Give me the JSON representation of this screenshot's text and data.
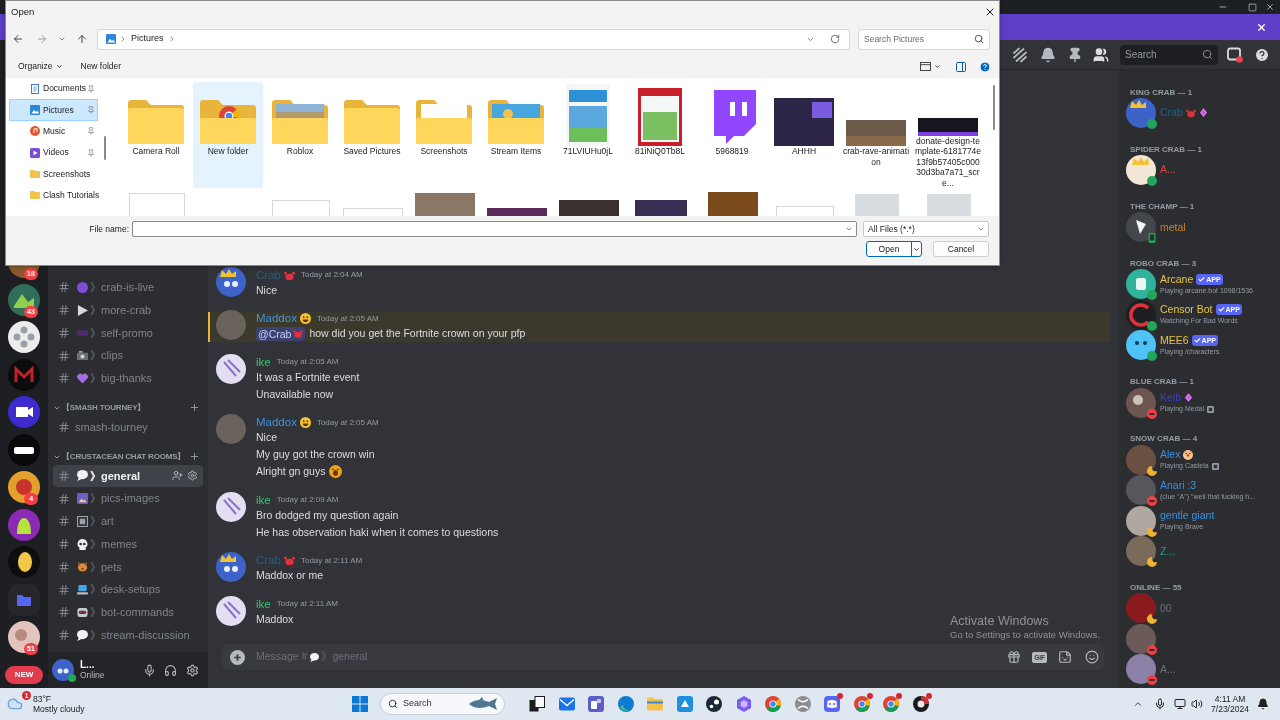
{
  "file_dialog": {
    "title": "Open",
    "path": "Pictures",
    "search": {
      "placeholder": "Search Pictures"
    },
    "toolbar": [
      {
        "label": "Organize",
        "kind": "menu"
      },
      {
        "label": "New folder",
        "kind": "button"
      }
    ],
    "nav": [
      {
        "label": "Documents",
        "pinned": true,
        "selected": false
      },
      {
        "label": "Pictures",
        "pinned": true,
        "selected": true
      },
      {
        "label": "Music",
        "pinned": true,
        "selected": false
      },
      {
        "label": "Videos",
        "pinned": true,
        "selected": false
      },
      {
        "label": "Screenshots",
        "pinned": false,
        "selected": false
      },
      {
        "label": "Clash Tutorials",
        "pinned": false,
        "selected": false
      }
    ],
    "items": [
      {
        "name": "Camera Roll",
        "kind": "folder",
        "highlighted": false
      },
      {
        "name": "New folder",
        "kind": "folder_preview",
        "highlighted": true
      },
      {
        "name": "Roblox",
        "kind": "folder_preview",
        "highlighted": false
      },
      {
        "name": "Saved Pictures",
        "kind": "folder",
        "highlighted": false
      },
      {
        "name": "Screenshots",
        "kind": "folder_preview",
        "highlighted": false
      },
      {
        "name": "Stream Items",
        "kind": "folder_preview",
        "highlighted": false
      },
      {
        "name": "71LVIUHu0jL",
        "kind": "image",
        "highlighted": false
      },
      {
        "name": "81iNiQ0Tb8L",
        "kind": "image",
        "highlighted": false
      },
      {
        "name": "5968819",
        "kind": "image",
        "highlighted": false
      },
      {
        "name": "AHHH",
        "kind": "image",
        "highlighted": false
      },
      {
        "name": "crab-rave-animation",
        "kind": "image",
        "highlighted": false
      },
      {
        "name": "donate-design-template-6181774e13f9b57405c00030d3ba7a71_scre...",
        "kind": "image",
        "highlighted": false
      }
    ],
    "file_name_label": "File name:",
    "filter": "All Files (*.*)",
    "buttons": [
      {
        "label": "Open",
        "primary": true
      },
      {
        "label": "Cancel",
        "primary": false
      }
    ]
  },
  "discord": {
    "servers": [
      {
        "kind": "server",
        "badge": "18"
      },
      {
        "kind": "server",
        "badge": "43"
      },
      {
        "kind": "server"
      },
      {
        "kind": "server"
      },
      {
        "kind": "server"
      },
      {
        "kind": "server"
      },
      {
        "kind": "server",
        "badge": "4"
      },
      {
        "kind": "server"
      },
      {
        "kind": "server"
      },
      {
        "kind": "folder"
      },
      {
        "kind": "server",
        "badge": "51"
      },
      {
        "kind": "new",
        "label": "NEW"
      }
    ],
    "channels": [
      {
        "kind": "channel",
        "name": "》crab-is-live",
        "selected": false
      },
      {
        "kind": "channel",
        "name": "》more-crab",
        "selected": false
      },
      {
        "kind": "channel",
        "name": "》self-promo",
        "selected": false
      },
      {
        "kind": "channel",
        "name": "》clips",
        "selected": false
      },
      {
        "kind": "channel",
        "name": "》big-thanks",
        "selected": false
      },
      {
        "kind": "category",
        "name": "【SMASH TOURNEY】",
        "expanded": true
      },
      {
        "kind": "plain_channel",
        "name": "smash-tourney",
        "selected": false
      },
      {
        "kind": "category",
        "name": "【CRUSTACEAN CHAT ROOMS】",
        "expanded": true
      },
      {
        "kind": "channel",
        "name": "》general",
        "selected": true
      },
      {
        "kind": "channel",
        "name": "》pics-images",
        "selected": false
      },
      {
        "kind": "channel",
        "name": "》art",
        "selected": false
      },
      {
        "kind": "channel",
        "name": "》memes",
        "selected": false
      },
      {
        "kind": "channel",
        "name": "》pets",
        "selected": false
      },
      {
        "kind": "channel",
        "name": "》desk-setups",
        "selected": false
      },
      {
        "kind": "channel",
        "name": "》bot-commands",
        "selected": false
      },
      {
        "kind": "channel",
        "name": "》stream-discussion",
        "selected": false
      }
    ],
    "user": {
      "name": "L...",
      "status": "Online",
      "kind": "online"
    },
    "search": {
      "placeholder": "Search"
    },
    "messages": [
      {
        "author": "Crab",
        "color": "#22608a",
        "time": "Today at 2:04 AM",
        "mentioned": false,
        "lines": [
          {
            "kind": "text",
            "text": "Nice"
          }
        ]
      },
      {
        "author": "Maddox",
        "color": "#3f93d9",
        "time": "Today at 2:05 AM",
        "mentioned": true,
        "lines": [
          {
            "kind": "mention",
            "mention": "@Crab",
            "text": "how did you get the Fortnite crown on your pfp"
          }
        ]
      },
      {
        "author": "ike",
        "color": "#2fcc6a",
        "time": "Today at 2:05 AM",
        "mentioned": false,
        "lines": [
          {
            "kind": "text",
            "text": "It was a Fortnite event"
          },
          {
            "kind": "text",
            "text": "Unavailable now"
          }
        ]
      },
      {
        "author": "Maddox",
        "color": "#3f93d9",
        "time": "Today at 2:05 AM",
        "mentioned": false,
        "lines": [
          {
            "kind": "text",
            "text": "Nice"
          },
          {
            "kind": "text",
            "text": "My guy got the crown win"
          },
          {
            "kind": "emoji",
            "text": "Alright gn guys"
          }
        ]
      },
      {
        "author": "ike",
        "color": "#2fcc6a",
        "time": "Today at 2:09 AM",
        "mentioned": false,
        "lines": [
          {
            "kind": "text",
            "text": "Bro dodged my question again"
          },
          {
            "kind": "text",
            "text": "He has observation haki when it comes to questions"
          }
        ]
      },
      {
        "author": "Crab",
        "color": "#22608a",
        "time": "Today at 2:11 AM",
        "mentioned": false,
        "lines": [
          {
            "kind": "text",
            "text": "Maddox or me"
          }
        ]
      },
      {
        "author": "ike",
        "color": "#2fcc6a",
        "time": "Today at 2:11 AM",
        "mentioned": false,
        "lines": [
          {
            "kind": "text",
            "text": "Maddox"
          }
        ]
      }
    ],
    "composer": {
      "placeholder": "Message #",
      "channel": "》general",
      "gif_label": "GIF"
    },
    "member_sections": [
      {
        "title": "KING CRAB — 1",
        "members": [
          {
            "name": "Crab",
            "color": "#22608a",
            "kind": "online",
            "boosting": true
          }
        ]
      },
      {
        "title": "SPIDER CRAB — 1",
        "members": [
          {
            "name": "A...",
            "color": "#d8453f",
            "kind": "online",
            "boosting": false
          }
        ]
      },
      {
        "title": "THE CHAMP — 1",
        "members": [
          {
            "name": "metal",
            "color": "#c8802e",
            "kind": "mobile",
            "boosting": false
          }
        ]
      },
      {
        "title": "ROBO CRAB — 3",
        "members": [
          {
            "name": "Arcane",
            "color": "#e8c547",
            "kind": "online",
            "boosting": false,
            "tag": "APP",
            "activity": "Playing arcane.bot 1098/1536"
          },
          {
            "name": "Censor Bot",
            "color": "#e8c547",
            "kind": "online",
            "boosting": false,
            "tag": "APP",
            "activity": "Watching For Bad Words"
          },
          {
            "name": "MEE6",
            "color": "#e8c547",
            "kind": "online",
            "boosting": false,
            "tag": "APP",
            "activity": "Playing /characters"
          }
        ]
      },
      {
        "title": "BLUE CRAB — 1",
        "members": [
          {
            "name": "Kelb",
            "color": "#3f3bd1",
            "kind": "dnd",
            "boosting": true,
            "activity": "Playing Medal"
          }
        ]
      },
      {
        "title": "SNOW CRAB — 4",
        "members": [
          {
            "name": "Alex",
            "color": "#3d8fdc",
            "kind": "idle",
            "boosting": false,
            "activity": "Playing Castela"
          },
          {
            "name": "Anari :3",
            "color": "#3d8fdc",
            "kind": "dnd",
            "boosting": false,
            "activity": "(clue \"A\") \"well that fucking h..."
          },
          {
            "name": "gentle giant",
            "color": "#3d8fdc",
            "kind": "idle",
            "boosting": false,
            "activity": "Playing Brave"
          },
          {
            "name": "Z...",
            "color": "#1f9e86",
            "kind": "idle",
            "boosting": false
          }
        ]
      },
      {
        "title": "ONLINE — 55",
        "members": [
          {
            "name": "00",
            "color": "#6d7079",
            "kind": "idle",
            "boosting": false
          },
          {
            "kind": "dnd",
            "boosting": false
          },
          {
            "name": "A...",
            "color": "#6d7079",
            "kind": "dnd",
            "boosting": false
          }
        ]
      }
    ]
  },
  "taskbar": {
    "weather": {
      "badge": "1",
      "temperature": "83°F",
      "condition": "Mostly cloudy"
    },
    "search": {
      "placeholder": "Search"
    },
    "apps": [
      {
        "kind": "squares",
        "badge": false
      },
      {
        "kind": "envelope",
        "badge": false
      },
      {
        "kind": "tile_purple",
        "badge": false
      },
      {
        "kind": "swirl",
        "badge": false
      },
      {
        "kind": "folder",
        "badge": false
      },
      {
        "kind": "tile_blue",
        "badge": false
      },
      {
        "kind": "disc",
        "badge": false
      },
      {
        "kind": "hexagon",
        "badge": false
      },
      {
        "kind": "ring",
        "badge": false
      },
      {
        "kind": "sphere",
        "badge": false
      },
      {
        "kind": "chat",
        "badge": true
      },
      {
        "kind": "ring",
        "badge": true
      },
      {
        "kind": "ring",
        "badge": true
      },
      {
        "kind": "dark_ring",
        "badge": true
      }
    ],
    "time": "4:11 AM",
    "date": "7/23/2024"
  },
  "activation": {
    "title": "Activate Windows",
    "text": "Go to Settings to activate Windows."
  }
}
